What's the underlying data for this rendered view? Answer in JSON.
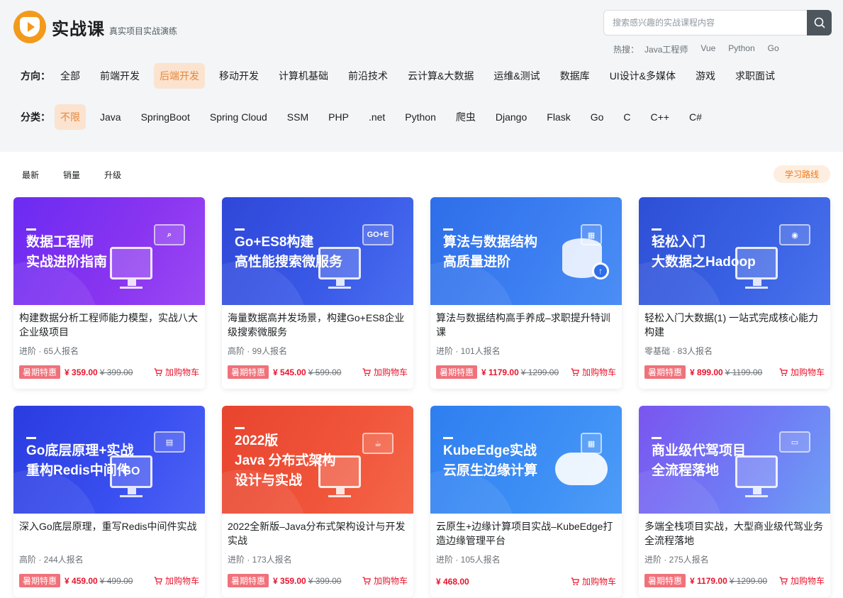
{
  "brand": {
    "title": "实战课",
    "subtitle": "真实项目实战演练"
  },
  "search": {
    "placeholder": "搜索感兴趣的实战课程内容"
  },
  "hot": {
    "label": "热搜：",
    "items": [
      "Java工程师",
      "Vue",
      "Python",
      "Go"
    ]
  },
  "direction": {
    "label": "方向：",
    "items": [
      "全部",
      "前端开发",
      "后端开发",
      "移动开发",
      "计算机基础",
      "前沿技术",
      "云计算&大数据",
      "运维&测试",
      "数据库",
      "UI设计&多媒体",
      "游戏",
      "求职面试"
    ],
    "active": "后端开发"
  },
  "category": {
    "label": "分类：",
    "items": [
      "不限",
      "Java",
      "SpringBoot",
      "Spring Cloud",
      "SSM",
      "PHP",
      ".net",
      "Python",
      "爬虫",
      "Django",
      "Flask",
      "Go",
      "C",
      "C++",
      "C#"
    ],
    "active": "不限"
  },
  "sort": {
    "items": [
      "最新",
      "销量",
      "升级"
    ]
  },
  "route_button": "学习路线",
  "colors": {
    "accent": "#f07a1a",
    "price": "#e8142c",
    "promo": "#f0717a"
  },
  "courses": [
    {
      "banner_title": "数据工程师\n实战进阶指南",
      "title": "构建数据分析工程师能力模型，实战八大企业级项目",
      "meta": "进阶 · 65人报名",
      "promo": "暑期特惠",
      "price": "¥ 359.00",
      "original": "¥ 399.00",
      "cart": "加购物车",
      "icon": "chart-icon"
    },
    {
      "banner_title": "Go+ES8构建\n高性能搜索微服务",
      "title": "海量数据高并发场景，构建Go+ES8企业级搜索微服务",
      "meta": "高阶 · 99人报名",
      "promo": "暑期特惠",
      "price": "¥ 545.00",
      "original": "¥ 599.00",
      "cart": "加购物车",
      "icon": "search-icon",
      "tag": "GO+E"
    },
    {
      "banner_title": "算法与数据结构\n高质量进阶",
      "title": "算法与数据结构高手养成–求职提升特训课",
      "meta": "进阶 · 101人报名",
      "promo": "暑期特惠",
      "price": "¥ 1179.00",
      "original": "¥ 1299.00",
      "cart": "加购物车",
      "icon": "database-icon"
    },
    {
      "banner_title": "轻松入门\n大数据之Hadoop",
      "title": "轻松入门大数据(1) 一站式完成核心能力构建",
      "meta": "零基础 · 83人报名",
      "promo": "暑期特惠",
      "price": "¥ 899.00",
      "original": "¥ 1199.00",
      "cart": "加购物车",
      "icon": "line-chart-icon"
    },
    {
      "banner_title": "Go底层原理+实战\n重构Redis中间件",
      "title": "深入Go底层原理，重写Redis中间件实战",
      "meta": "高阶 · 244人报名",
      "promo": "暑期特惠",
      "price": "¥ 459.00",
      "original": "¥ 499.00",
      "cart": "加购物车",
      "icon": "go-icon",
      "tag": "GO"
    },
    {
      "banner_title": "2022版\nJava 分布式架构\n设计与实战",
      "title": "2022全新版–Java分布式架构设计与开发实战",
      "meta": "进阶 · 173人报名",
      "promo": "暑期特惠",
      "price": "¥ 359.00",
      "original": "¥ 399.00",
      "cart": "加购物车",
      "icon": "java-icon"
    },
    {
      "banner_title": "KubeEdge实战\n云原生边缘计算",
      "title": "云原生+边缘计算项目实战–KubeEdge打造边缘管理平台",
      "meta": "进阶 · 105人报名",
      "promo": "",
      "price": "¥ 468.00",
      "original": "",
      "cart": "加购物车",
      "icon": "cloud-icon"
    },
    {
      "banner_title": "商业级代驾项目\n全流程落地",
      "title": "多端全栈项目实战，大型商业级代驾业务全流程落地",
      "meta": "进阶 · 275人报名",
      "promo": "暑期特惠",
      "price": "¥ 1179.00",
      "original": "¥ 1299.00",
      "cart": "加购物车",
      "icon": "car-icon"
    }
  ]
}
